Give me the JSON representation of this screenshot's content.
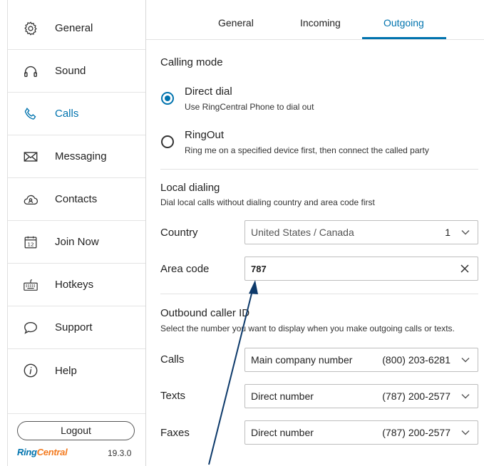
{
  "sidebar": {
    "items": [
      {
        "label": "General",
        "icon": "gear-icon"
      },
      {
        "label": "Sound",
        "icon": "headphones-icon"
      },
      {
        "label": "Calls",
        "icon": "phone-icon"
      },
      {
        "label": "Messaging",
        "icon": "envelope-icon"
      },
      {
        "label": "Contacts",
        "icon": "cloud-contacts-icon"
      },
      {
        "label": "Join Now",
        "icon": "calendar-icon"
      },
      {
        "label": "Hotkeys",
        "icon": "keyboard-icon"
      },
      {
        "label": "Support",
        "icon": "chat-bubble-icon"
      },
      {
        "label": "Help",
        "icon": "info-icon"
      }
    ],
    "active": "Calls",
    "logout_label": "Logout",
    "brand_part1": "Ring",
    "brand_part2": "Central",
    "version": "19.3.0"
  },
  "tabs": [
    {
      "label": "General"
    },
    {
      "label": "Incoming"
    },
    {
      "label": "Outgoing"
    }
  ],
  "active_tab": "Outgoing",
  "calling_mode": {
    "title": "Calling mode",
    "options": [
      {
        "title": "Direct dial",
        "subtitle": "Use RingCentral Phone to dial out",
        "selected": true
      },
      {
        "title": "RingOut",
        "subtitle": "Ring me on a specified device first, then connect the called party",
        "selected": false
      }
    ]
  },
  "local_dialing": {
    "title": "Local dialing",
    "subtitle": "Dial local calls without dialing country and area code first",
    "country_label": "Country",
    "country_value": "United States / Canada",
    "country_code": "1",
    "area_code_label": "Area code",
    "area_code_value": "787"
  },
  "outbound_caller_id": {
    "title": "Outbound caller ID",
    "subtitle": "Select the number you want to display when you make outgoing calls or texts.",
    "rows": [
      {
        "label": "Calls",
        "name": "Main company number",
        "number": "(800) 203-6281"
      },
      {
        "label": "Texts",
        "name": "Direct number",
        "number": "(787) 200-2577"
      },
      {
        "label": "Faxes",
        "name": "Direct number",
        "number": "(787) 200-2577"
      }
    ]
  },
  "colors": {
    "accent": "#0073ae",
    "brand_orange": "#f37b20",
    "annotation_arrow": "#0d3a6b"
  }
}
